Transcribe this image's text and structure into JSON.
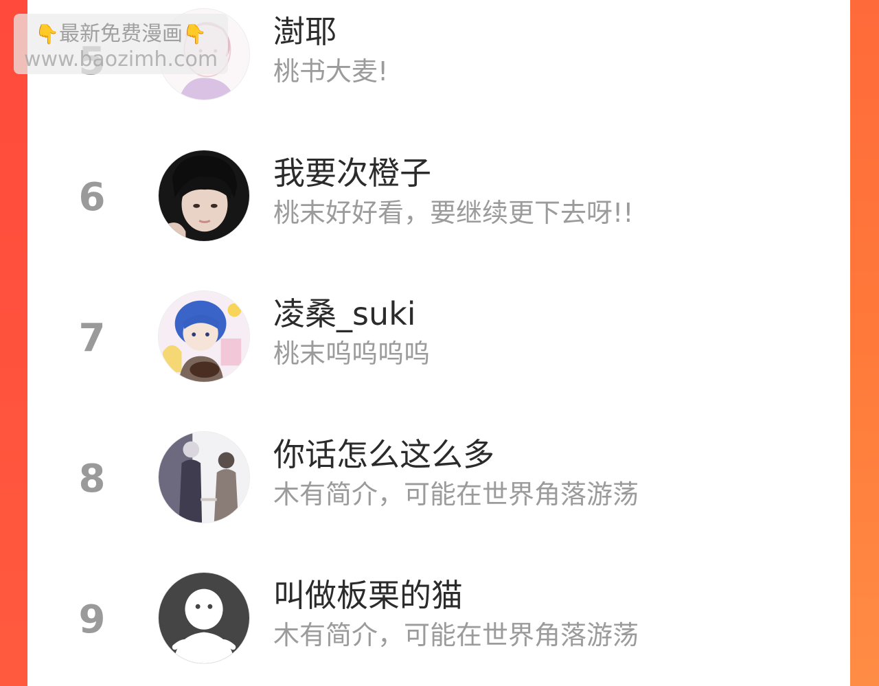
{
  "watermark": {
    "line1": "最新免费漫画",
    "line2": "www.baozimh.com",
    "icon_left": "pointing-down-hand",
    "icon_right": "pointing-down-hand"
  },
  "ranking": [
    {
      "rank": "5",
      "name": "澍耶",
      "bio": "桃书大麦!",
      "avatar": "anime-girl-avatar"
    },
    {
      "rank": "6",
      "name": "我要次橙子",
      "bio": "桃末好好看，要继续更下去呀!!",
      "avatar": "photo-person-avatar"
    },
    {
      "rank": "7",
      "name": "凌桑_suki",
      "bio": "桃末呜呜呜呜",
      "avatar": "anime-boy-avatar"
    },
    {
      "rank": "8",
      "name": "你话怎么这么多",
      "bio": "木有简介，可能在世界角落游荡",
      "avatar": "couple-illustration-avatar"
    },
    {
      "rank": "9",
      "name": "叫做板栗的猫",
      "bio": "木有简介，可能在世界角落游荡",
      "avatar": "default-user-avatar"
    }
  ],
  "colors": {
    "frame_left": "#ff4a3c",
    "frame_right": "#ff7a3a",
    "rank_text": "#9a9a9a",
    "name_text": "#2b2b2b",
    "bio_text": "#9b9b9b"
  }
}
